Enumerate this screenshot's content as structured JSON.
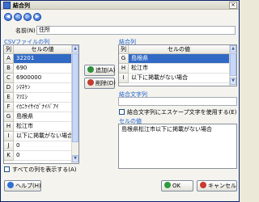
{
  "window": {
    "title": "結合列",
    "close_glyph": "×"
  },
  "toolbar": {
    "nav": [
      "◀",
      "◁",
      "▷",
      "▶"
    ]
  },
  "name_field": {
    "label": "名前(N)",
    "value": "住所"
  },
  "csv_group": {
    "label": "CSVファイルの列",
    "headers": {
      "col": "列",
      "value": "セルの値"
    },
    "rows": [
      {
        "col": "A",
        "value": "32201"
      },
      {
        "col": "B",
        "value": "690"
      },
      {
        "col": "C",
        "value": "6900000"
      },
      {
        "col": "D",
        "value": "ｼﾏﾈｹﾝ"
      },
      {
        "col": "E",
        "value": "ﾏﾂｴｼ"
      },
      {
        "col": "F",
        "value": "ｲｶﾆｹｲｻｲｶﾞﾅｲﾊﾞｱｲ"
      },
      {
        "col": "G",
        "value": "島根県"
      },
      {
        "col": "H",
        "value": "松江市"
      },
      {
        "col": "I",
        "value": "以下に掲載がない場合"
      },
      {
        "col": "J",
        "value": "0"
      },
      {
        "col": "K",
        "value": "0"
      }
    ],
    "selected_index": 0
  },
  "add_button": {
    "label": "追加(A)"
  },
  "remove_button": {
    "label": "削除(D)"
  },
  "joined_group": {
    "label": "結合列",
    "headers": {
      "col": "列",
      "value": "セルの値"
    },
    "rows": [
      {
        "col": "G",
        "value": "島根県"
      },
      {
        "col": "H",
        "value": "松江市"
      },
      {
        "col": "I",
        "value": "以下に掲載がない場合"
      }
    ],
    "selected_index": 0
  },
  "joined_string": {
    "label": "結合文字列",
    "value": ""
  },
  "escape_checkbox": {
    "label": "結合文字列にエスケープ文字を使用する(E)",
    "checked": false
  },
  "cell_value": {
    "label": "セルの値",
    "value": "島根県松江市以下に掲載がない場合"
  },
  "show_all_checkbox": {
    "label": "すべての列を表示する(A)",
    "checked": false
  },
  "buttons": {
    "help": "ヘルプ(H)",
    "ok": "OK",
    "cancel": "キャンセル"
  }
}
